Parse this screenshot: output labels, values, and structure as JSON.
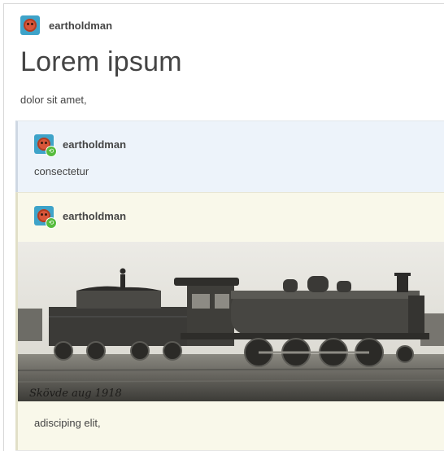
{
  "post": {
    "username": "eartholdman",
    "title": "Lorem ipsum",
    "body": "dolor sit amet,",
    "avatar_icon": "avatar-icon"
  },
  "reblogs": [
    {
      "username": "eartholdman",
      "text": "consectetur",
      "background": "#edf3fa",
      "badge_icon": "reblog-icon"
    },
    {
      "username": "eartholdman",
      "text": "adisciping elit,",
      "background": "#f9f8ea",
      "badge_icon": "reblog-icon",
      "photo": {
        "caption": "Skövde aug 1918"
      }
    }
  ]
}
